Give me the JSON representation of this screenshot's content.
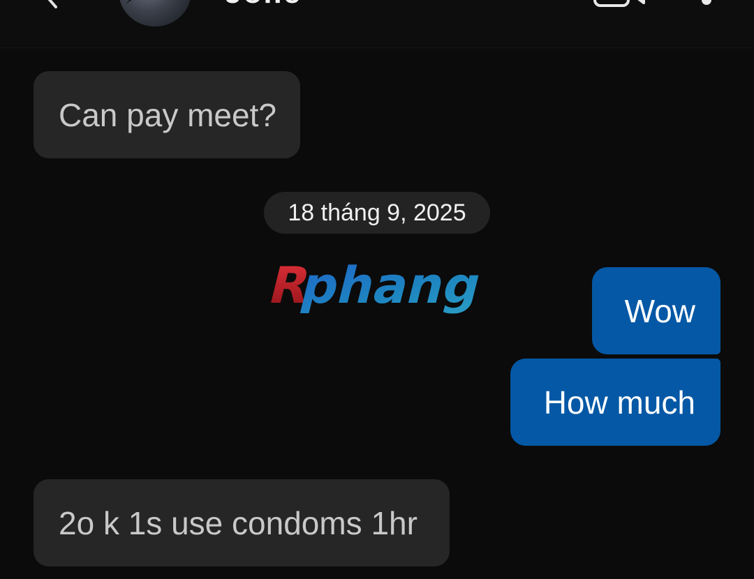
{
  "header": {
    "contact_name": "Jolie"
  },
  "date_separator": "18 tháng 9, 2025",
  "messages": [
    {
      "direction": "incoming",
      "text": "Can pay meet?"
    },
    {
      "direction": "outgoing",
      "text": "Wow"
    },
    {
      "direction": "outgoing",
      "text": "How much"
    },
    {
      "direction": "incoming",
      "text": "2o k 1s use condoms 1hr"
    }
  ],
  "watermark": {
    "text": "Rphang"
  },
  "colors": {
    "background": "#0b0b0b",
    "incoming_bubble": "#262626",
    "outgoing_bubble": "#0458a5",
    "date_pill": "#232323",
    "watermark_red": "#c8222a",
    "watermark_blue": "#1c6bb8"
  },
  "icons": {
    "back": "arrow-left-icon",
    "video": "video-camera-icon",
    "more": "more-vertical-icon"
  }
}
